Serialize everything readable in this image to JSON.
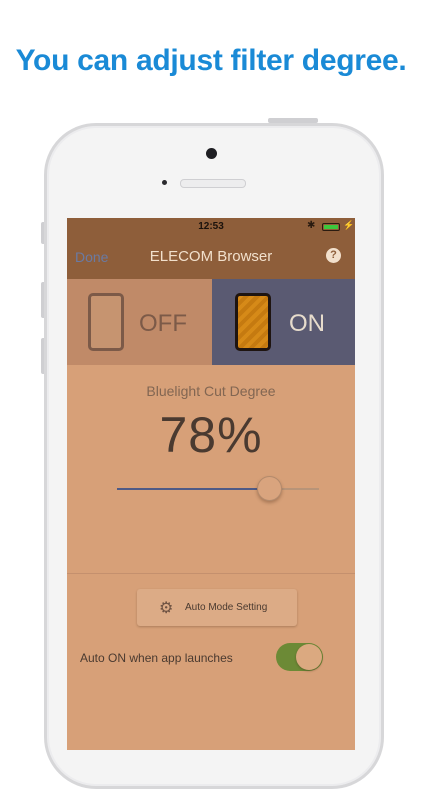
{
  "headline": "You can adjust filter degree.",
  "status_bar": {
    "time": "12:53",
    "battery_level": 1.0,
    "battery_color": "#3cc83c"
  },
  "nav": {
    "done_label": "Done",
    "title": "ELECOM Browser",
    "help_icon": "?"
  },
  "filter_toggle": {
    "off_label": "OFF",
    "on_label": "ON",
    "selected": "ON"
  },
  "bluelight": {
    "label": "Bluelight Cut Degree",
    "value_text": "78%",
    "slider_value": 0.75
  },
  "auto_mode": {
    "button_label": "Auto Mode Setting",
    "icon": "gear-icon"
  },
  "auto_on": {
    "label": "Auto ON when app launches",
    "enabled": true
  },
  "colors": {
    "accent_headline": "#1a8ad6",
    "filter_tint": "#d7a078",
    "toggle_on": "#6c8a36"
  }
}
